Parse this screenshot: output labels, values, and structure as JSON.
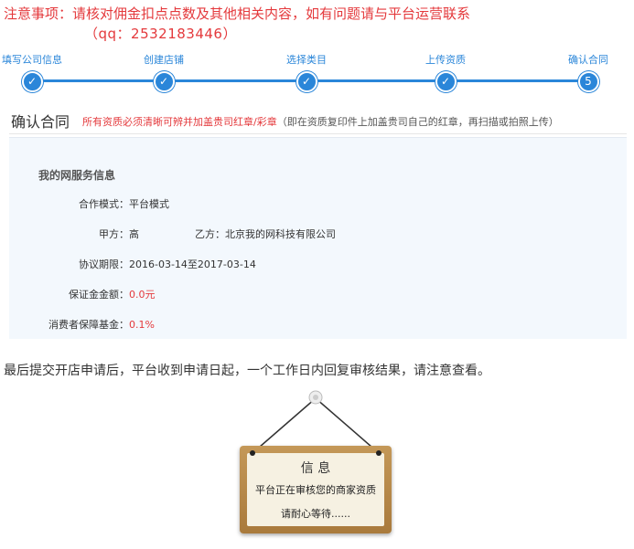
{
  "notice": {
    "text": "注意事项：请核对佣金扣点点数及其他相关内容，如有问题请与平台运营联系",
    "qq": "（qq：2532183446）"
  },
  "steps": [
    {
      "label": "填写公司信息",
      "state": "done"
    },
    {
      "label": "创建店铺",
      "state": "done"
    },
    {
      "label": "选择类目",
      "state": "done"
    },
    {
      "label": "上传资质",
      "state": "done"
    },
    {
      "label": "确认合同",
      "state": "current",
      "number": "5"
    }
  ],
  "contract": {
    "title": "确认合同",
    "warning": "所有资质必须清晰可辨并加盖贵司红章/彩章",
    "note": "（即在资质复印件上加盖贵司自己的红章，再扫描或拍照上传）",
    "section_title": "我的网服务信息",
    "mode_label": "合作模式：",
    "mode_value": "平台模式",
    "party_a_label": "甲方：",
    "party_a_value": "高",
    "party_b_label": "乙方：",
    "party_b_value": "北京我的网科技有限公司",
    "period_label": "协议期限：",
    "period_value": "2016-03-14至2017-03-14",
    "deposit_label": "保证金金额：",
    "deposit_value": "0.0元",
    "fund_label": "消费者保障基金：",
    "fund_value": "0.1%"
  },
  "bottom_message": "最后提交开店申请后，平台收到申请日起，一个工作日内回复审核结果，请注意查看。",
  "sign": {
    "title": "信 息",
    "line1": "平台正在审核您的商家资质",
    "line2": "请耐心等待......"
  },
  "colors": {
    "accent": "#2a86d9",
    "warning": "#e4393c",
    "info_bg": "#f3f8fd",
    "sign_wood": "#b8894a"
  },
  "icons": {
    "step_done": "checkmark-icon",
    "sign_nail": "nail-icon"
  }
}
